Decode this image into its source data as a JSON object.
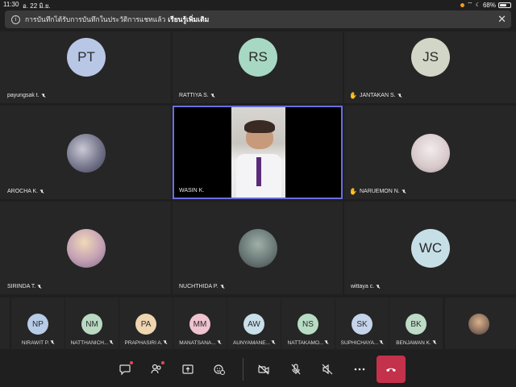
{
  "status_bar": {
    "time": "11:30",
    "date": "อ. 22 มิ.ย.",
    "battery": "68%"
  },
  "banner": {
    "text": "การบันทึกได้รับการบันทึกในประวัติการแชทแล้ว",
    "link": "เรียนรู้เพิ่มเติม"
  },
  "tiles": [
    {
      "name": "payungsak t.",
      "initials": "PT",
      "color": "#b8c7e6"
    },
    {
      "name": "RATTIYA S.",
      "initials": "RS",
      "color": "#a7d8c3"
    },
    {
      "name": "JANTAKAN S.",
      "initials": "JS",
      "color": "#d2d6c6"
    },
    {
      "name": "AROCHA K."
    },
    {
      "name": "WASIN K."
    },
    {
      "name": "NARUEMON N."
    },
    {
      "name": "SIRINDA T."
    },
    {
      "name": "NUCHTHIDA P."
    },
    {
      "name": "wittaya c.",
      "initials": "WC",
      "color": "#c6dfe7"
    }
  ],
  "strip": [
    {
      "name": "NIRAWIT P.",
      "initials": "NP",
      "color": "#b8cce8"
    },
    {
      "name": "NATTHANICH...",
      "initials": "NM",
      "color": "#b9d9c2"
    },
    {
      "name": "PRAPHASIRI A.",
      "initials": "PA",
      "color": "#efd6b0"
    },
    {
      "name": "MANATSANA...",
      "initials": "MM",
      "color": "#efc3cf"
    },
    {
      "name": "AUNYAMANE...",
      "initials": "AW",
      "color": "#c9dfe9"
    },
    {
      "name": "NATTAKAMO...",
      "initials": "NS",
      "color": "#b7dcc4"
    },
    {
      "name": "SUPHICHAYA...",
      "initials": "SK",
      "color": "#c5d4ea"
    },
    {
      "name": "BENJAWAN K.",
      "initials": "BK",
      "color": "#bedbc8"
    }
  ],
  "icons": {
    "chat": "chat-icon",
    "participants": "participants-icon",
    "share": "share-icon",
    "reactions": "reactions-icon",
    "camera": "camera-off-icon",
    "mic": "mic-off-icon",
    "speaker": "speaker-off-icon",
    "more": "more-icon",
    "hangup": "hangup-icon"
  },
  "colors": {
    "accent": "#6a6ee0",
    "hangup": "#c4314b",
    "badge": "#e04a5f"
  }
}
